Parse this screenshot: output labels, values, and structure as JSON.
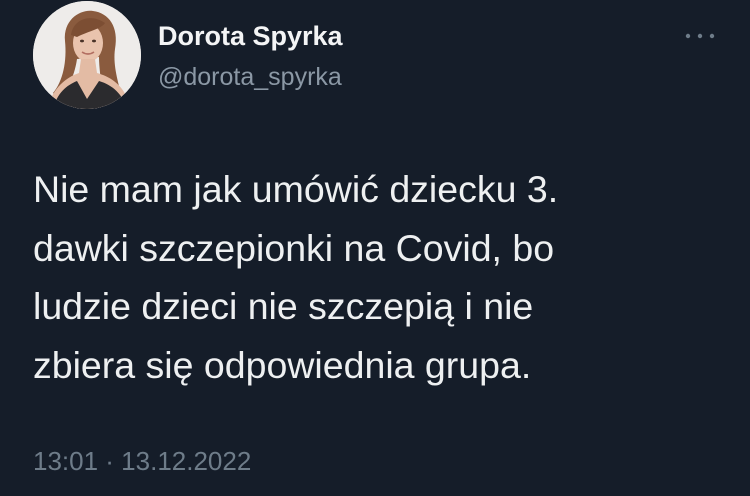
{
  "tweet": {
    "author": {
      "display_name": "Dorota Spyrka",
      "handle": "@dorota_spyrka"
    },
    "text": "Nie mam jak umówić dziecku 3.\ndawki szczepionki na Covid, bo\nludzie dzieci nie szczepią i nie\nzbiera się odpowiednia grupa.",
    "timestamp": "13:01 · 13.12.2022"
  },
  "colors": {
    "background": "#151d29",
    "text_primary": "#eef0f1",
    "text_secondary": "#8b98a5"
  },
  "icons": {
    "more": "more-horizontal-icon"
  }
}
